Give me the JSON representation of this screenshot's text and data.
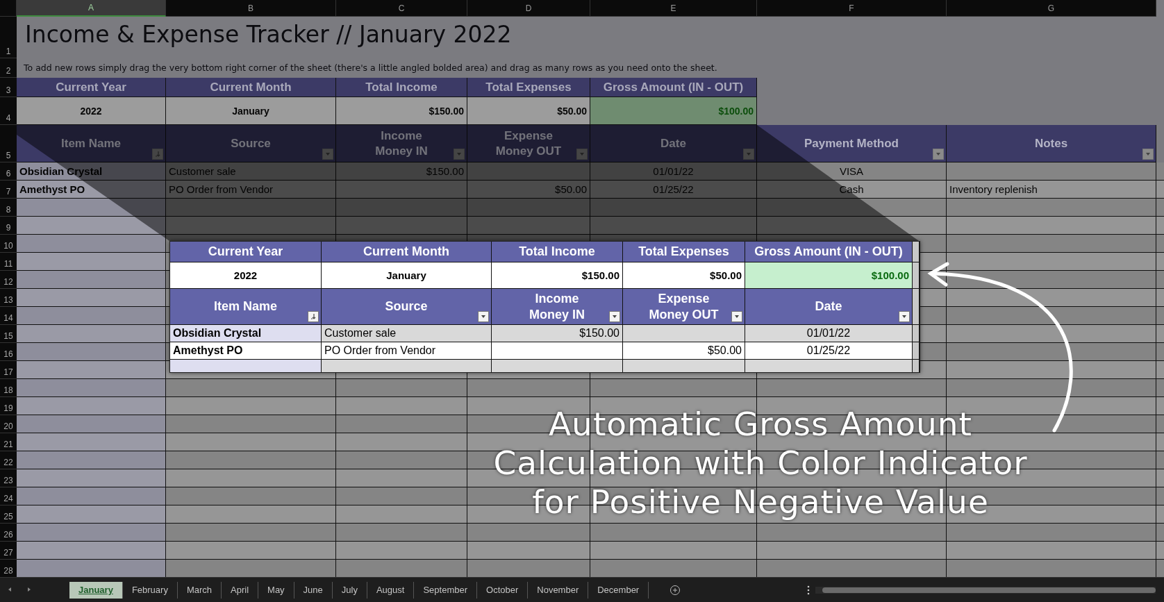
{
  "column_headers": [
    {
      "label": "A",
      "selected": true
    },
    {
      "label": "B",
      "selected": false
    },
    {
      "label": "C",
      "selected": false
    },
    {
      "label": "D",
      "selected": false
    },
    {
      "label": "E",
      "selected": false
    },
    {
      "label": "F",
      "selected": false
    },
    {
      "label": "G",
      "selected": false
    }
  ],
  "row_numbers": [
    "1",
    "2",
    "3",
    "4",
    "5",
    "6",
    "7",
    "8",
    "9",
    "10",
    "11",
    "12",
    "13",
    "14",
    "15",
    "16",
    "17",
    "18",
    "19",
    "20",
    "21",
    "22",
    "23",
    "24",
    "25",
    "26",
    "27",
    "28"
  ],
  "title": "Income & Expense Tracker // January 2022",
  "instructions": "To add new rows simply drag the very bottom right corner of the sheet (there's a little angled bolded area) and drag as many rows as you need onto the sheet.",
  "summary": {
    "headers": [
      "Current Year",
      "Current Month",
      "Total Income",
      "Total Expenses",
      "Gross Amount (IN - OUT)"
    ],
    "values": [
      "2022",
      "January",
      "$150.00",
      "$50.00",
      "$100.00"
    ],
    "gross_positive": true
  },
  "table": {
    "headers": [
      {
        "label": "Item Name",
        "kind": "sort"
      },
      {
        "label": "Source",
        "kind": "filter"
      },
      {
        "label": "Income\nMoney IN",
        "kind": "filter"
      },
      {
        "label": "Expense\nMoney OUT",
        "kind": "filter"
      },
      {
        "label": "Date",
        "kind": "filter"
      },
      {
        "label": "Payment Method",
        "kind": "filter"
      },
      {
        "label": "Notes",
        "kind": "filter"
      }
    ],
    "rows": [
      {
        "item_name": "Obsidian Crystal",
        "source": "Customer sale",
        "income": "$150.00",
        "date": "01/01/22",
        "payment_method": "VISA"
      },
      {
        "item_name": "Amethyst PO",
        "source": "PO Order from Vendor",
        "expense": "$50.00",
        "date": "01/25/22",
        "payment_method": "Cash",
        "notes": "Inventory replenish"
      }
    ]
  },
  "inset": {
    "summary": {
      "headers": [
        "Current Year",
        "Current Month",
        "Total Income",
        "Total Expenses",
        "Gross Amount (IN - OUT)"
      ],
      "values": [
        "2022",
        "January",
        "$150.00",
        "$50.00",
        "$100.00"
      ],
      "gross_positive": true
    },
    "headers": [
      {
        "label": "Item Name",
        "kind": "sort"
      },
      {
        "label": "Source",
        "kind": "filter"
      },
      {
        "label": "Income\nMoney IN",
        "kind": "filter"
      },
      {
        "label": "Expense\nMoney OUT",
        "kind": "filter"
      },
      {
        "label": "Date",
        "kind": "filter"
      }
    ],
    "rows": [
      {
        "item_name": "Obsidian Crystal",
        "source": "Customer sale",
        "income": "$150.00",
        "date": "01/01/22"
      },
      {
        "item_name": "Amethyst PO",
        "source": "PO Order from Vendor",
        "expense": "$50.00",
        "date": "01/25/22"
      }
    ]
  },
  "annotation": [
    "Automatic Gross Amount",
    "Calculation with Color Indicator",
    "for Positive Negative Value"
  ],
  "sheet_tabs": [
    {
      "label": "January",
      "selected": true
    },
    {
      "label": "February",
      "selected": false
    },
    {
      "label": "March",
      "selected": false
    },
    {
      "label": "April",
      "selected": false
    },
    {
      "label": "May",
      "selected": false
    },
    {
      "label": "June",
      "selected": false
    },
    {
      "label": "July",
      "selected": false
    },
    {
      "label": "August",
      "selected": false
    },
    {
      "label": "September",
      "selected": false
    },
    {
      "label": "October",
      "selected": false
    },
    {
      "label": "November",
      "selected": false
    },
    {
      "label": "December",
      "selected": false
    }
  ]
}
